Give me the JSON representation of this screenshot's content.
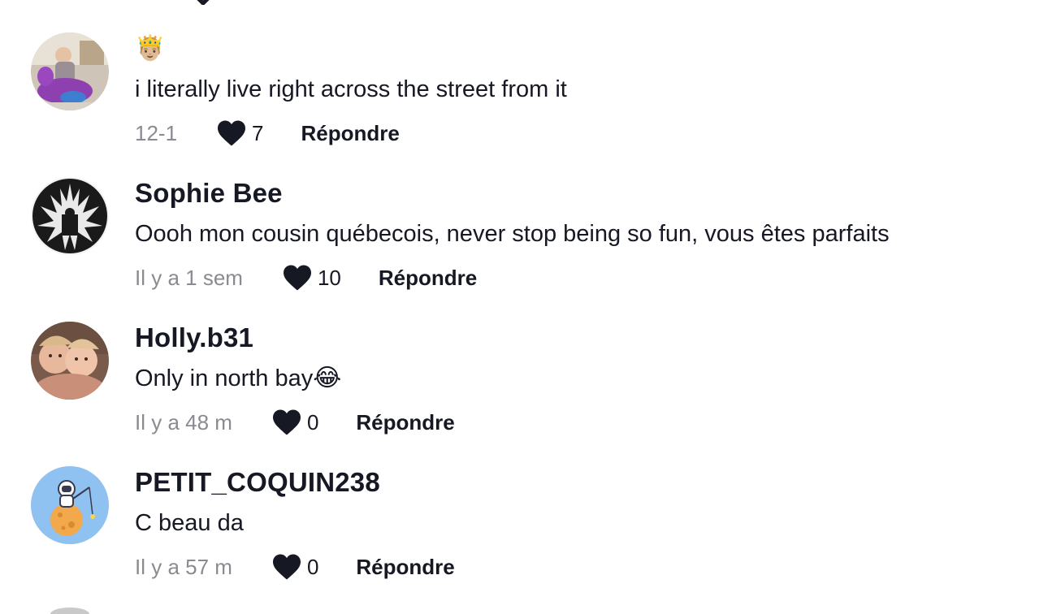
{
  "comments": [
    {
      "username": "",
      "username_emoji": "🤴🏼",
      "text": "i literally live right across the street from it",
      "time": "12-1",
      "likes": "7",
      "reply_label": "Répondre"
    },
    {
      "username": "Sophie Bee",
      "text": "Oooh mon cousin québecois, never stop being so fun, vous êtes parfaits",
      "time": "Il y a 1 sem",
      "likes": "10",
      "reply_label": "Répondre"
    },
    {
      "username": "Holly.b31",
      "text": "Only in north bay",
      "text_emoji": "😂",
      "time": "Il y a 48 m",
      "likes": "0",
      "reply_label": "Répondre"
    },
    {
      "username": "PETIT_COQUIN238",
      "text": "C beau da",
      "time": "Il y a 57 m",
      "likes": "0",
      "reply_label": "Répondre"
    }
  ],
  "icons": {
    "like": "heart-icon"
  },
  "colors": {
    "text_primary": "#161823",
    "text_secondary": "#8a8b91",
    "background": "#ffffff"
  }
}
